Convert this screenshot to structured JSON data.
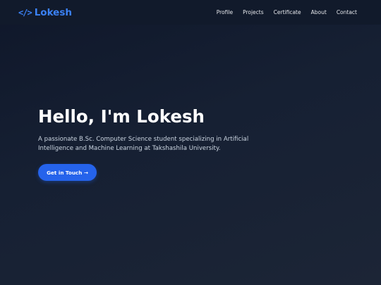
{
  "nav": {
    "logo_icon": "</>",
    "logo_text": "Lokesh",
    "links": [
      "Profile",
      "Projects",
      "Certificate",
      "About",
      "Contact"
    ]
  },
  "hero": {
    "title": "Hello, I'm Lokesh",
    "description": "A passionate B.Sc. Computer Science student specializing in Artificial Intelligence and Machine Learning at Takshashila University.",
    "cta_label": "Get in Touch →"
  },
  "colors": {
    "accent": "#3b82f6",
    "button": "#2563eb",
    "background": "#0f172a"
  }
}
